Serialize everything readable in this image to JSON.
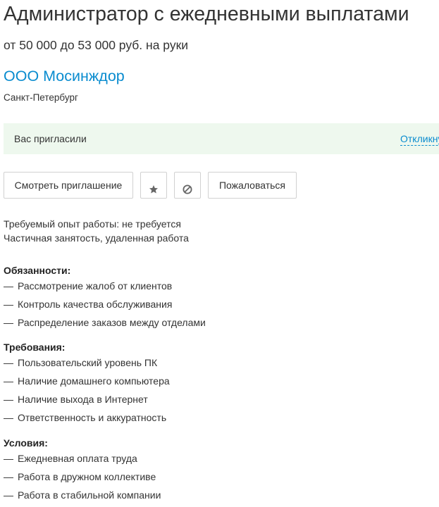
{
  "vacancy": {
    "title": "Администратор с ежедневными выплатами",
    "salary": "от 50 000 до 53 000 руб. на руки",
    "company": "ООО Мосинждор",
    "city": "Санкт-Петербург"
  },
  "invitation": {
    "text": "Вас пригласили",
    "link": "Откликнуться"
  },
  "actions": {
    "view_invitation": "Смотреть приглашение",
    "favorite_icon": "star-icon",
    "hide_icon": "block-icon",
    "report": "Пожаловаться"
  },
  "meta": {
    "experience": "Требуемый опыт работы: не требуется",
    "employment": "Частичная занятость, удаленная работа"
  },
  "sections": [
    {
      "title": "Обязанности:",
      "items": [
        "Рассмотрение жалоб от клиентов",
        "Контроль качества обслуживания",
        "Распределение заказов между отделами"
      ]
    },
    {
      "title": "Требования:",
      "items": [
        "Пользовательский уровень ПК",
        "Наличие домашнего компьютера",
        "Наличие выхода в Интернет",
        "Ответственность и аккуратность"
      ]
    },
    {
      "title": "Условия:",
      "items": [
        "Ежедневная оплата труда",
        "Работа в дружном коллективе",
        "Работа в стабильной компании"
      ]
    }
  ],
  "list_marker": "—",
  "colors": {
    "link": "#0a8ccf",
    "invite_bg": "#eef8ee",
    "text": "#333333",
    "border": "#d1d1d1"
  }
}
